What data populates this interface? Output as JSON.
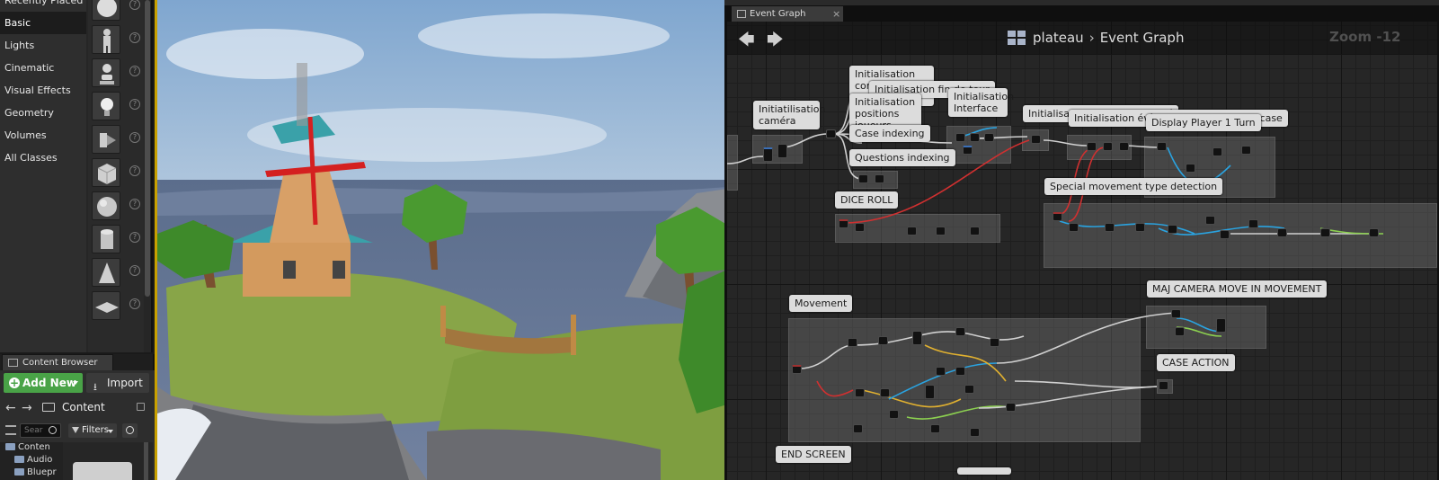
{
  "place_panel": {
    "categories": [
      {
        "label": "Recently Placed",
        "active": false
      },
      {
        "label": "Basic",
        "active": true
      },
      {
        "label": "Lights",
        "active": false
      },
      {
        "label": "Cinematic",
        "active": false
      },
      {
        "label": "Visual Effects",
        "active": false
      },
      {
        "label": "Geometry",
        "active": false
      },
      {
        "label": "Volumes",
        "active": false
      },
      {
        "label": "All Classes",
        "active": false
      }
    ],
    "shape_icons": [
      "sphere-reflection-icon",
      "character-icon",
      "pawn-icon",
      "point-light-icon",
      "player-start-icon",
      "cube-icon",
      "sphere-icon",
      "cylinder-icon",
      "cone-icon",
      "plane-icon"
    ]
  },
  "content_browser": {
    "tab_label": "Content Browser",
    "add_new_label": "Add New",
    "import_label": "Import",
    "path_label": "Content",
    "search_placeholder": "Sear",
    "filters_label": "Filters",
    "tree_items": [
      "Conten",
      "Audio",
      "Bluepr"
    ]
  },
  "blueprint": {
    "tab_label": "Event Graph",
    "breadcrumb_root": "plateau",
    "breadcrumb_current": "Event Graph",
    "zoom_text": "Zoom -12",
    "comments": [
      {
        "title": "Initialisation compteur de tour"
      },
      {
        "title": "Initialisation fin de tour"
      },
      {
        "title": "Initialisation positions joueurs"
      },
      {
        "title": "Initiatilisation caméra"
      },
      {
        "title": "Case indexing"
      },
      {
        "title": "Questions indexing"
      },
      {
        "title": "Initialisation Interface"
      },
      {
        "title": "Initialisation bouton jet de dé"
      },
      {
        "title": "Initialisation évènement mouvement case"
      },
      {
        "title": "Display Player 1 Turn"
      },
      {
        "title": "DICE ROLL"
      },
      {
        "title": "Special movement type detection"
      },
      {
        "title": "Movement"
      },
      {
        "title": "MAJ CAMERA MOVE IN MOVEMENT"
      },
      {
        "title": "CASE ACTION"
      },
      {
        "title": "END SCREEN"
      }
    ]
  },
  "colors": {
    "accent_green": "#49a347",
    "viewport_border": "#c8a000",
    "exec_wire": "#d0d0d0",
    "data_wire_blue": "#2aa3e0",
    "data_wire_red": "#d03030",
    "data_wire_yellow": "#e0b030",
    "data_wire_green": "#8cd050"
  }
}
